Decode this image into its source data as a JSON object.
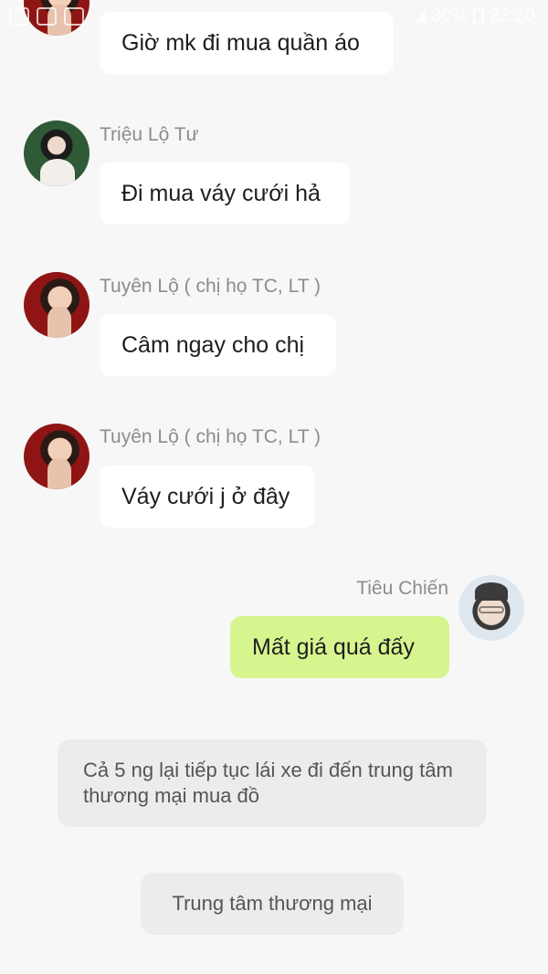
{
  "status_bar": {
    "battery": "30%",
    "time": "22:20"
  },
  "messages": [
    {
      "sender": "",
      "text": "Giờ mk đi mua quần áo"
    },
    {
      "sender": "Triệu Lộ Tư",
      "text": "Đi mua váy cưới hả"
    },
    {
      "sender": "Tuyên Lộ ( chị họ TC, LT )",
      "text": "Câm ngay cho chị"
    },
    {
      "sender": "Tuyên Lộ ( chị họ TC, LT )",
      "text": "Váy cưới j ở đây"
    },
    {
      "sender": "Tiêu Chiến",
      "text": "Mất giá quá đấy"
    }
  ],
  "narrations": [
    "Cả 5 ng lại tiếp tục lái xe đi đến trung tâm thương mại mua đồ",
    "Trung tâm thương mại"
  ],
  "colors": {
    "background": "#f7f7f7",
    "incoming_bubble": "#ffffff",
    "outgoing_bubble": "#d7f58f",
    "narration_bubble": "#ececec",
    "name_text": "#8c8c8c"
  }
}
